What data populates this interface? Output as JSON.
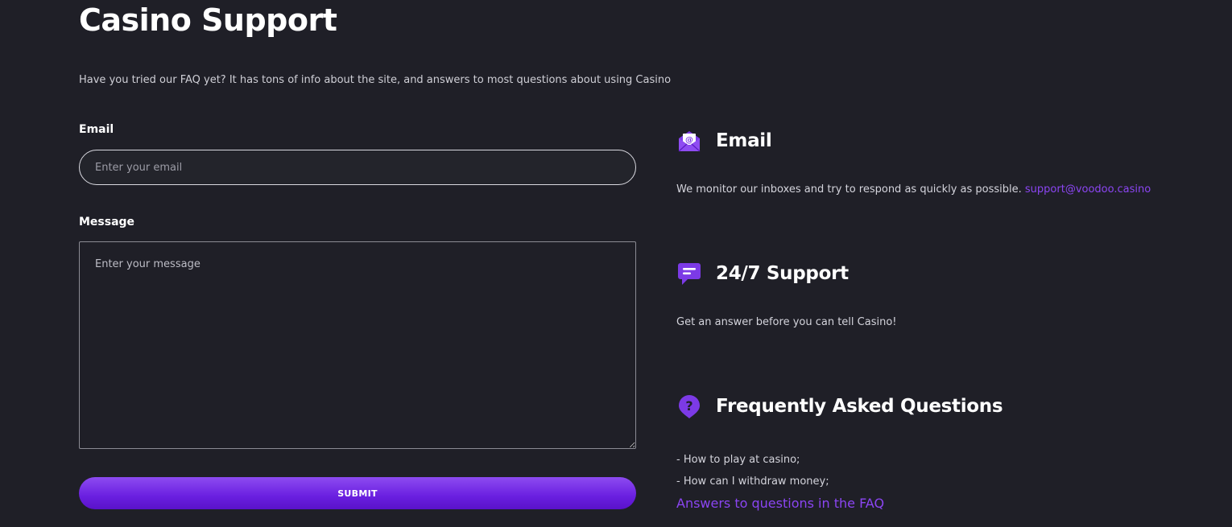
{
  "page": {
    "title": "Casino Support",
    "intro": "Have you tried our FAQ yet? It has tons of info about the site, and answers to most questions about using Casino"
  },
  "form": {
    "email_label": "Email",
    "email_placeholder": "Enter your email",
    "email_value": "",
    "message_label": "Message",
    "message_placeholder": "Enter your message",
    "message_value": "",
    "submit_label": "SUBMIT"
  },
  "info": {
    "email": {
      "icon": "envelope-at-icon",
      "title": "Email",
      "text": "We monitor our inboxes and try to respond as quickly as possible.",
      "link": "support@voodoo.casino"
    },
    "support": {
      "icon": "chat-bubble-icon",
      "title": "24/7 Support",
      "text": "Get an answer before you can tell Casino!"
    },
    "faq": {
      "icon": "question-pin-icon",
      "title": "Frequently Asked Questions",
      "items": [
        "- How to play at casino;",
        "- How can I withdraw money;"
      ],
      "link": "Answers to questions in the FAQ"
    }
  },
  "colors": {
    "background": "#1f1f27",
    "accent": "#8b45f2",
    "button": "#6a1fe0"
  }
}
